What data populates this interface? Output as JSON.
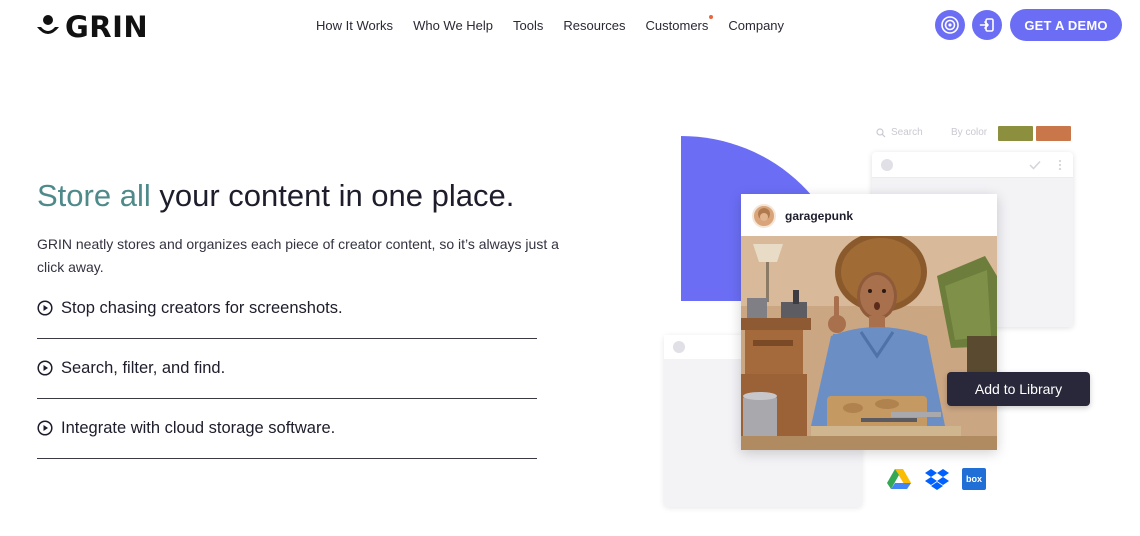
{
  "brand": {
    "name": "GRIN"
  },
  "nav": {
    "items": [
      {
        "label": "How It Works"
      },
      {
        "label": "Who We Help"
      },
      {
        "label": "Tools"
      },
      {
        "label": "Resources"
      },
      {
        "label": "Customers",
        "badge": true
      },
      {
        "label": "Company"
      }
    ]
  },
  "header": {
    "icons": [
      "podcast-icon",
      "login-icon"
    ],
    "cta_label": "GET A DEMO"
  },
  "hero": {
    "title_accent": "Store all",
    "title_rest": " your content in one place.",
    "description": "GRIN neatly stores and organizes each piece of creator content, so it’s always just a click away.",
    "features": [
      {
        "label": "Stop chasing creators for screenshots."
      },
      {
        "label": "Search, filter, and find."
      },
      {
        "label": "Integrate with cloud storage software."
      }
    ]
  },
  "illustration": {
    "search_placeholder": "Search",
    "filter_label": "By color",
    "swatch_colors": [
      "#8c8f3d",
      "#c9774a"
    ],
    "accent_color": "#6b6ef5",
    "post_username": "garagepunk",
    "add_button_label": "Add to Library",
    "integrations": [
      "google-drive-icon",
      "dropbox-icon",
      "box-icon"
    ],
    "box_label": "box"
  },
  "colors": {
    "primary": "#6b6ef5",
    "title_accent": "#4f8a8b",
    "dark_button": "#29283b",
    "nav_badge": "#e8663d"
  }
}
